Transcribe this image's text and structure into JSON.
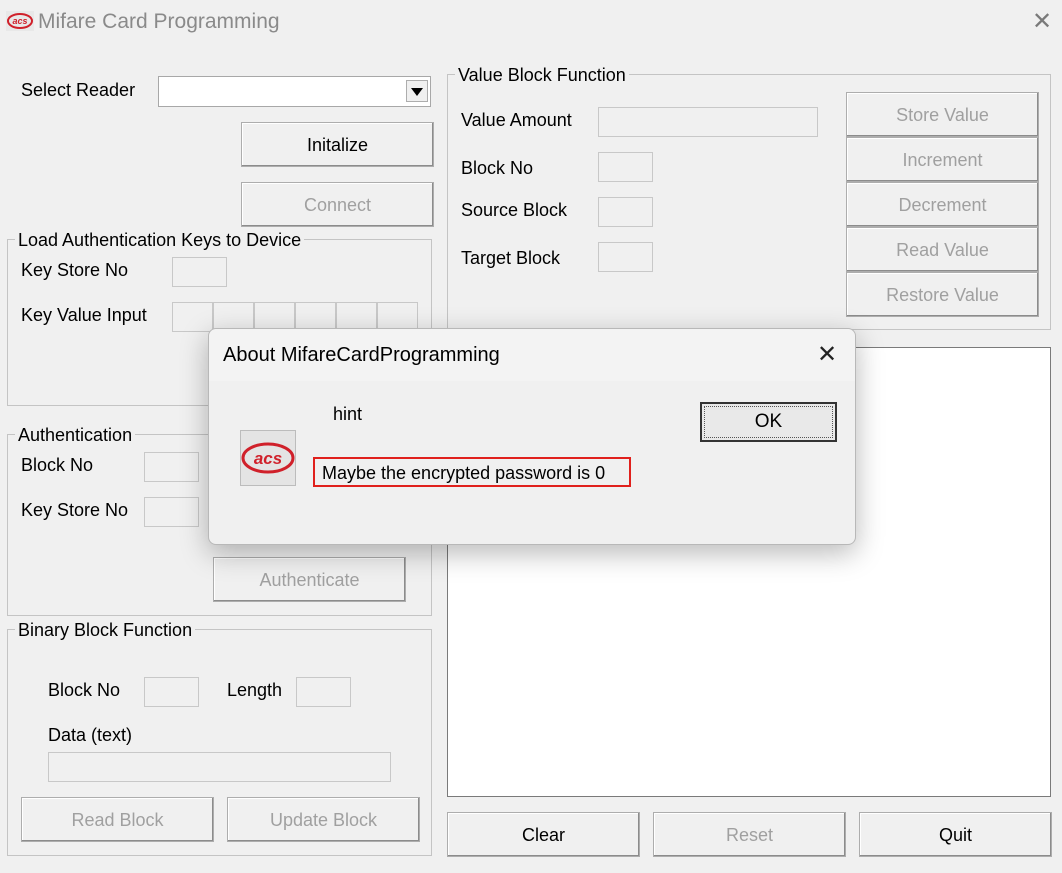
{
  "window": {
    "title": "Mifare Card Programming",
    "close_glyph": "✕"
  },
  "reader": {
    "label": "Select Reader",
    "selected": "",
    "initialize": "Initalize",
    "connect": "Connect"
  },
  "load_keys": {
    "caption": "Load Authentication Keys to Device",
    "key_store_no": "Key Store No",
    "key_value_input": "Key Value Input",
    "key_store_value": "",
    "key_bytes": [
      "",
      "",
      "",
      "",
      "",
      ""
    ]
  },
  "authentication": {
    "caption": "Authentication",
    "block_no": "Block No",
    "key_store_no": "Key Store No",
    "authenticate": "Authenticate"
  },
  "binary_block": {
    "caption": "Binary Block Function",
    "block_no": "Block No",
    "length": "Length",
    "data_text": "Data (text)",
    "read_block": "Read Block",
    "update_block": "Update Block"
  },
  "value_block": {
    "caption": "Value Block Function",
    "value_amount": "Value Amount",
    "block_no": "Block No",
    "source_block": "Source Block",
    "target_block": "Target Block",
    "buttons": [
      "Store Value",
      "Increment",
      "Decrement",
      "Read Value",
      "Restore Value"
    ]
  },
  "bottom_buttons": {
    "clear": "Clear",
    "reset": "Reset",
    "quit": "Quit"
  },
  "dialog": {
    "title": "About MifareCardProgramming",
    "close_glyph": "✕",
    "heading": "hint",
    "message": "Maybe the encrypted password is 0",
    "ok": "OK",
    "logo_text": "acs"
  },
  "colors": {
    "highlight": "#e0201c",
    "logo_red": "#d0202a",
    "disabled_text": "#a0a0a0"
  }
}
